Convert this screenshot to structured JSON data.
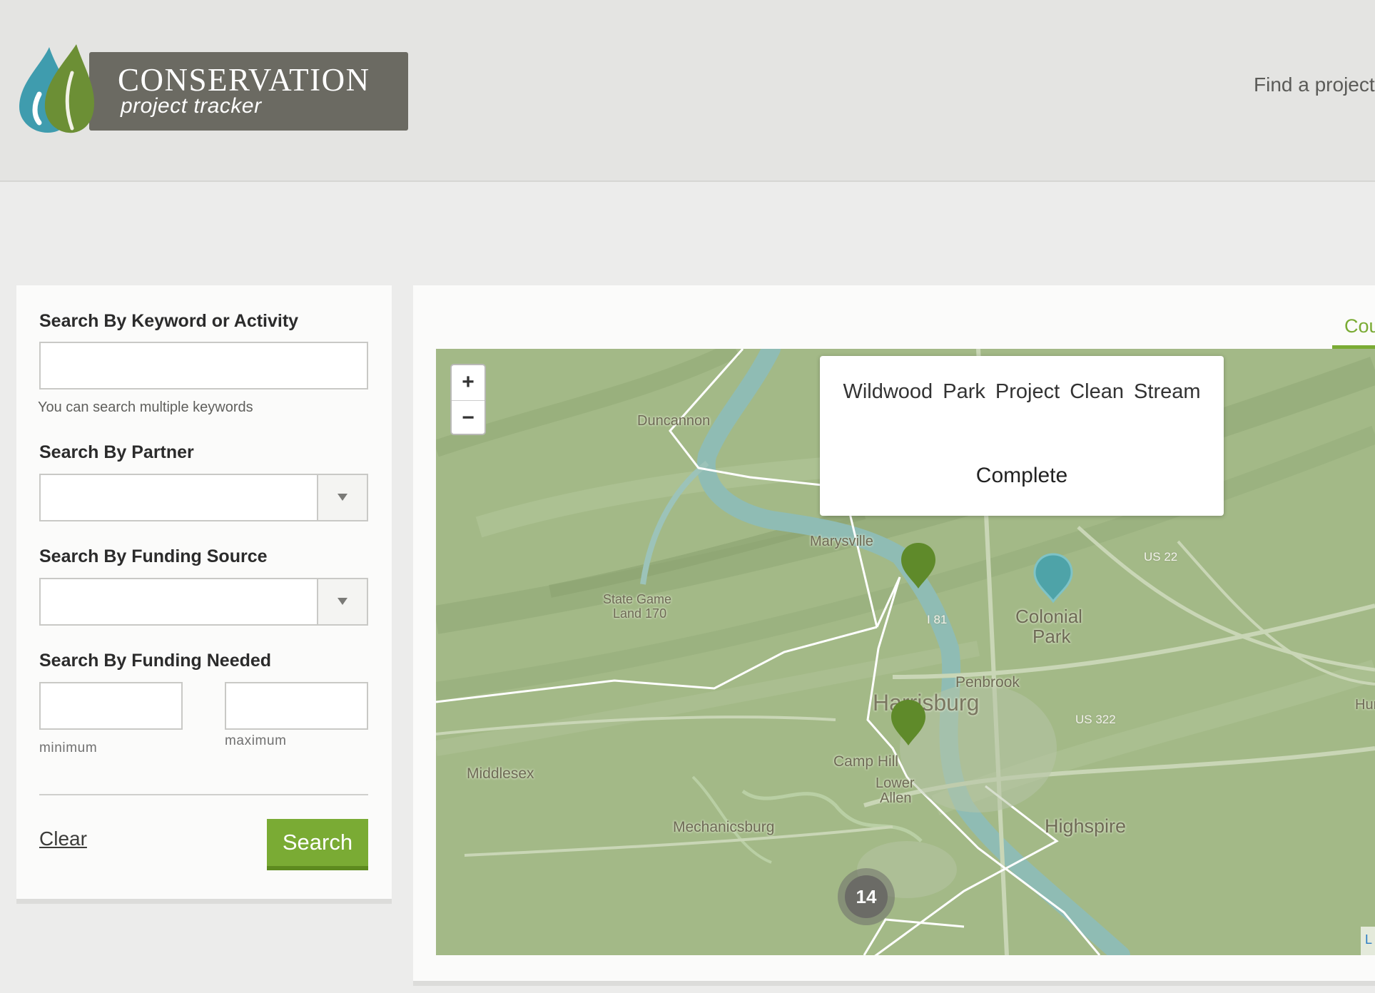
{
  "header": {
    "logo_title": "CONSERVATION",
    "logo_subtitle": "project tracker",
    "nav_find": "Find a project"
  },
  "sidebar": {
    "keyword_label": "Search By Keyword or Activity",
    "keyword_value": "",
    "keyword_help": "You can search multiple keywords",
    "partner_label": "Search By Partner",
    "partner_value": "",
    "funding_source_label": "Search By Funding Source",
    "funding_source_value": "",
    "funding_needed_label": "Search By Funding Needed",
    "min_value": "",
    "min_caption": "minimum",
    "max_value": "",
    "max_caption": "maximum",
    "clear_label": "Clear",
    "search_label": "Search"
  },
  "map_panel": {
    "tab_label": "Cou",
    "zoom_in": "+",
    "zoom_out": "−",
    "popup": {
      "title": "Wildwood Park Project Clean Stream",
      "status": "Complete"
    },
    "cluster_count": "14",
    "attribution": "L",
    "labels": {
      "duncannon": "Duncannon",
      "marysville": "Marysville",
      "state_game": "State Game",
      "land_170": "Land 170",
      "colonial": "Colonial",
      "park": "Park",
      "penbrook": "Penbrook",
      "harrisburg": "Harrisburg",
      "camp_hill": "Camp Hill",
      "lower": "Lower",
      "allen": "Allen",
      "middlesex": "Middlesex",
      "mechanicsburg": "Mechanicsburg",
      "highspire": "Highspire",
      "hum": "Hum",
      "i81": "I 81",
      "us22": "US 22",
      "us322": "US 322"
    },
    "colors": {
      "project_pin": "#5f8a2a",
      "selected_pin": "#4ea3a8",
      "accent": "#7aab34"
    }
  }
}
